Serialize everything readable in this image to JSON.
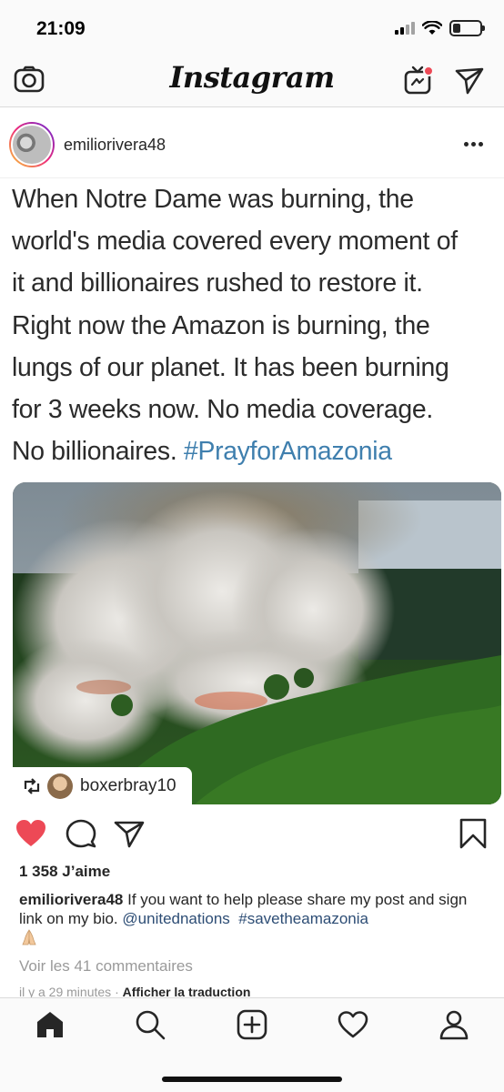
{
  "status_bar": {
    "time": "21:09"
  },
  "header": {
    "logo": "Instagram"
  },
  "post": {
    "username": "emiliorivera48",
    "text_lines": [
      "When Notre Dame was burning, the",
      "world's media covered every moment of",
      "it and billionaires rushed to restore it.",
      "Right now the Amazon is burning, the",
      "lungs of our planet. It has been burning",
      "for 3 weeks now. No media coverage.",
      "No billionaires."
    ],
    "text_hashtag": "#PrayforAmazonia",
    "photo_alt": "Aerial photo of a forest fire with heavy smoke",
    "repost_user": "boxerbray10"
  },
  "engagement": {
    "likes": "1 358 J’aime",
    "caption_user": "emiliorivera48",
    "caption_text": "If you want to help please share my post and sign link on my bio.",
    "caption_mention": "@unitednations",
    "caption_hashtag": "#savetheamazonia",
    "comments_link": "Voir les 41 commentaires",
    "time_ago": "il y a 29 minutes",
    "separator": "·",
    "translate": "Afficher la traduction"
  },
  "colors": {
    "like_red": "#ed4956",
    "hashtag_blue": "#3f7fae",
    "mention_blue": "#2d4d75",
    "notification_dot": "#ed4956"
  },
  "icons": [
    "camera-icon",
    "igtv-icon",
    "direct-icon",
    "more-icon",
    "repost-icon",
    "heart-filled-icon",
    "comment-icon",
    "share-icon",
    "bookmark-icon",
    "home-icon",
    "search-icon",
    "add-post-icon",
    "activity-heart-icon",
    "profile-icon"
  ]
}
